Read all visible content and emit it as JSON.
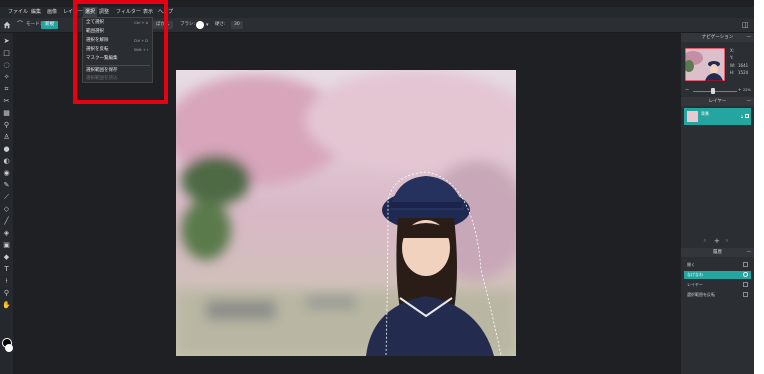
{
  "menubar": {
    "items": [
      "ファイル",
      "編集",
      "画像",
      "レイヤー",
      "選択",
      "調整",
      "フィルター",
      "表示",
      "ヘルプ"
    ],
    "active_index": 4
  },
  "options_bar": {
    "mode_label": "モード:",
    "mode_value": "新規",
    "feather_label": "ぼかし",
    "brush_label": "ブラシ:",
    "hardness_label": "硬さ:",
    "size_value": "30"
  },
  "select_menu": {
    "items": [
      {
        "label": "全て選択",
        "shortcut": "Ctrl + A",
        "disabled": false
      },
      {
        "label": "範囲選択",
        "shortcut": "",
        "disabled": false
      },
      {
        "label": "選択を解除",
        "shortcut": "Ctrl + D",
        "disabled": false
      },
      {
        "label": "選択を反転",
        "shortcut": "Shift + I",
        "disabled": false
      },
      {
        "label": "マスク一覧編集",
        "shortcut": "",
        "disabled": false
      },
      {
        "label": "選択範囲を保存",
        "shortcut": "",
        "disabled": false
      },
      {
        "label": "選択範囲を読込",
        "shortcut": "",
        "disabled": true
      }
    ]
  },
  "navigator": {
    "title": "ナビゲーション",
    "x_label": "X:",
    "y_label": "Y:",
    "w_label": "W:",
    "w_value": "1641",
    "h_label": "H:",
    "h_value": "1524",
    "zoom": "22%"
  },
  "layers": {
    "title": "レイヤー",
    "items": [
      {
        "name": "背景"
      }
    ]
  },
  "history": {
    "title": "履歴",
    "items": [
      {
        "label": "開く",
        "active": false
      },
      {
        "label": "なげなわ",
        "active": true
      },
      {
        "label": "レイヤー",
        "active": false
      },
      {
        "label": "選択範囲を反転",
        "active": false
      }
    ]
  },
  "colors": {
    "accent": "#24a5a0",
    "highlight": "#e50012"
  }
}
